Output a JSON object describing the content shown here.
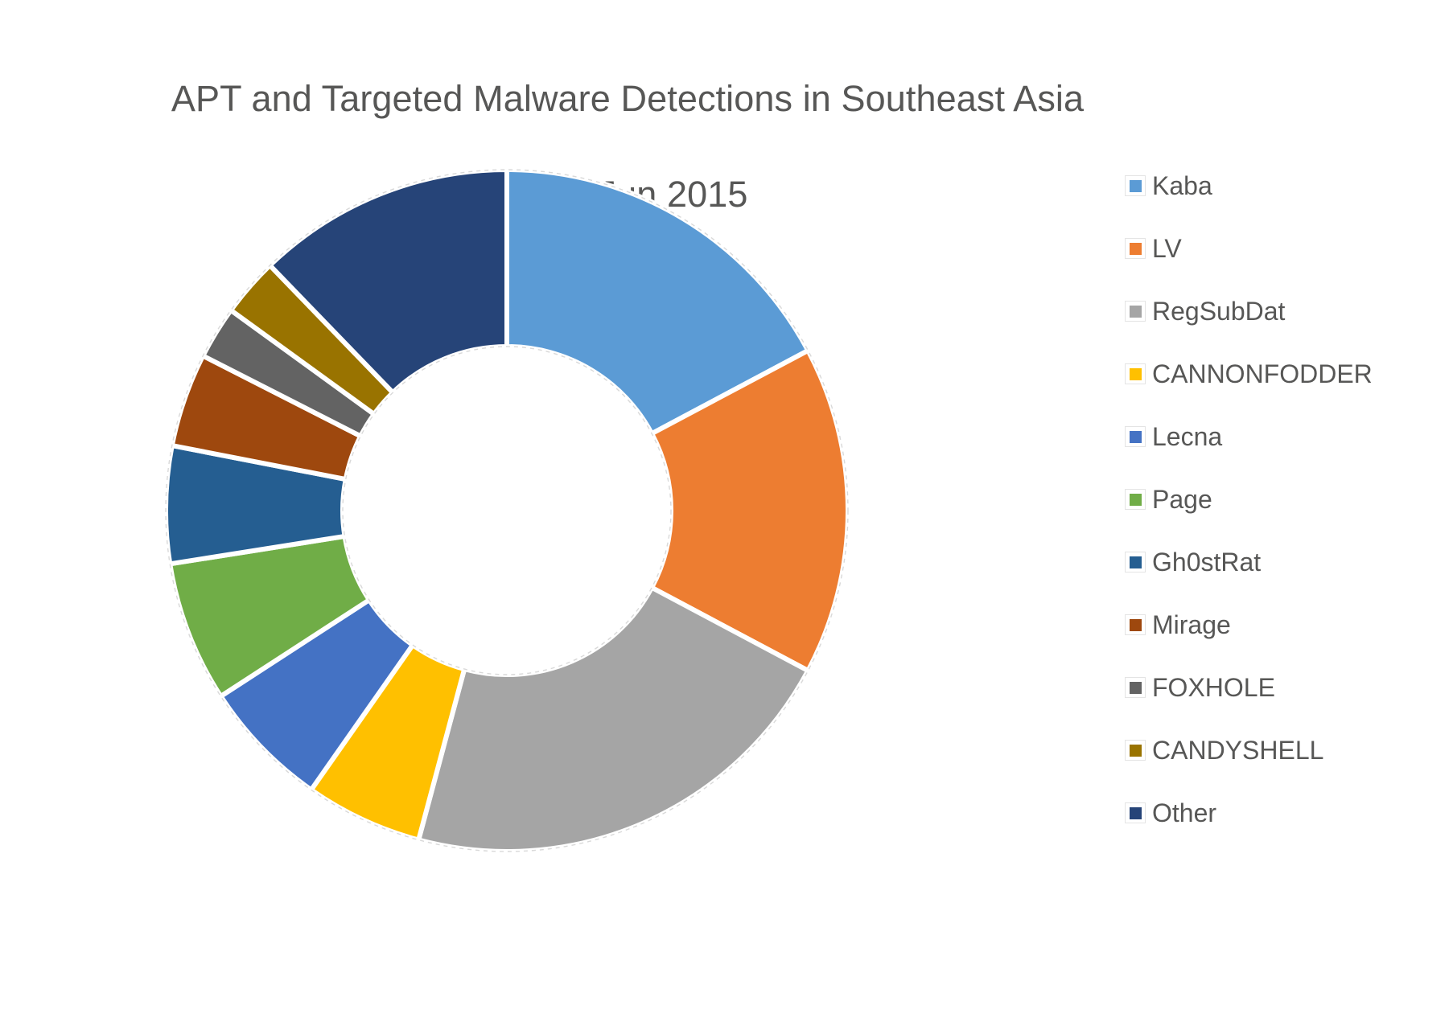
{
  "chart_title": {
    "line1": "APT and Targeted Malware Detections in Southeast Asia",
    "line2": "Jan - Jun 2015"
  },
  "legend": {
    "position": "right",
    "items": [
      {
        "label": "Kaba",
        "color": "#5B9BD5",
        "swatch_icon": "legend-swatch-icon"
      },
      {
        "label": "LV",
        "color": "#ED7D31",
        "swatch_icon": "legend-swatch-icon"
      },
      {
        "label": "RegSubDat",
        "color": "#A5A5A5",
        "swatch_icon": "legend-swatch-icon"
      },
      {
        "label": "CANNONFODDER",
        "color": "#FFC000",
        "swatch_icon": "legend-swatch-icon"
      },
      {
        "label": "Lecna",
        "color": "#4472C4",
        "swatch_icon": "legend-swatch-icon"
      },
      {
        "label": "Page",
        "color": "#70AD47",
        "swatch_icon": "legend-swatch-icon"
      },
      {
        "label": "Gh0stRat",
        "color": "#255E91",
        "swatch_icon": "legend-swatch-icon"
      },
      {
        "label": "Mirage",
        "color": "#9E480E",
        "swatch_icon": "legend-swatch-icon"
      },
      {
        "label": "FOXHOLE",
        "color": "#636363",
        "swatch_icon": "legend-swatch-icon"
      },
      {
        "label": "CANDYSHELL",
        "color": "#997300",
        "swatch_icon": "legend-swatch-icon"
      },
      {
        "label": "Other",
        "color": "#264478",
        "swatch_icon": "legend-swatch-icon"
      }
    ]
  },
  "chart_data": {
    "type": "pie",
    "variant": "doughnut",
    "title": "APT and Targeted Malware Detections in Southeast Asia Jan - Jun 2015",
    "subtitle": "Jan - Jun 2015",
    "xlabel": "",
    "ylabel": "",
    "grid": false,
    "legend_position": "right",
    "data_labels": false,
    "start_angle_deg": 0,
    "direction": "clockwise",
    "inner_radius_ratio": 0.48,
    "categories": [
      "Kaba",
      "LV",
      "RegSubDat",
      "CANNONFODDER",
      "Lecna",
      "Page",
      "Gh0stRat",
      "Mirage",
      "FOXHOLE",
      "CANDYSHELL",
      "Other"
    ],
    "values": [
      17.2,
      15.6,
      21.4,
      5.6,
      6.1,
      6.7,
      5.6,
      4.4,
      2.5,
      2.8,
      12.1
    ],
    "unit": "percent",
    "slices": [
      {
        "label": "Kaba",
        "percent": 17.2,
        "angle_deg": 62.0,
        "start_deg": 0.0,
        "end_deg": 62.0,
        "color": "#5B9BD5"
      },
      {
        "label": "LV",
        "percent": 15.6,
        "angle_deg": 56.0,
        "start_deg": 62.0,
        "end_deg": 118.0,
        "color": "#ED7D31"
      },
      {
        "label": "RegSubDat",
        "percent": 21.4,
        "angle_deg": 77.0,
        "start_deg": 118.0,
        "end_deg": 195.0,
        "color": "#A5A5A5"
      },
      {
        "label": "CANNONFODDER",
        "percent": 5.6,
        "angle_deg": 20.0,
        "start_deg": 195.0,
        "end_deg": 215.0,
        "color": "#FFC000"
      },
      {
        "label": "Lecna",
        "percent": 6.1,
        "angle_deg": 22.0,
        "start_deg": 215.0,
        "end_deg": 237.0,
        "color": "#4472C4"
      },
      {
        "label": "Page",
        "percent": 6.7,
        "angle_deg": 24.0,
        "start_deg": 237.0,
        "end_deg": 261.0,
        "color": "#70AD47"
      },
      {
        "label": "Gh0stRat",
        "percent": 5.6,
        "angle_deg": 20.0,
        "start_deg": 261.0,
        "end_deg": 281.0,
        "color": "#255E91"
      },
      {
        "label": "Mirage",
        "percent": 4.4,
        "angle_deg": 16.0,
        "start_deg": 281.0,
        "end_deg": 297.0,
        "color": "#9E480E"
      },
      {
        "label": "FOXHOLE",
        "percent": 2.5,
        "angle_deg": 9.0,
        "start_deg": 297.0,
        "end_deg": 306.0,
        "color": "#636363"
      },
      {
        "label": "CANDYSHELL",
        "percent": 2.8,
        "angle_deg": 10.0,
        "start_deg": 306.0,
        "end_deg": 316.0,
        "color": "#997300"
      },
      {
        "label": "Other",
        "percent": 12.1,
        "angle_deg": 44.0,
        "start_deg": 316.0,
        "end_deg": 360.0,
        "color": "#264478"
      }
    ],
    "colors": {
      "text": "#575756",
      "background": "#FFFFFF",
      "slice_border": "#FFFFFF",
      "plot_outline": "#D9D9D9"
    }
  }
}
